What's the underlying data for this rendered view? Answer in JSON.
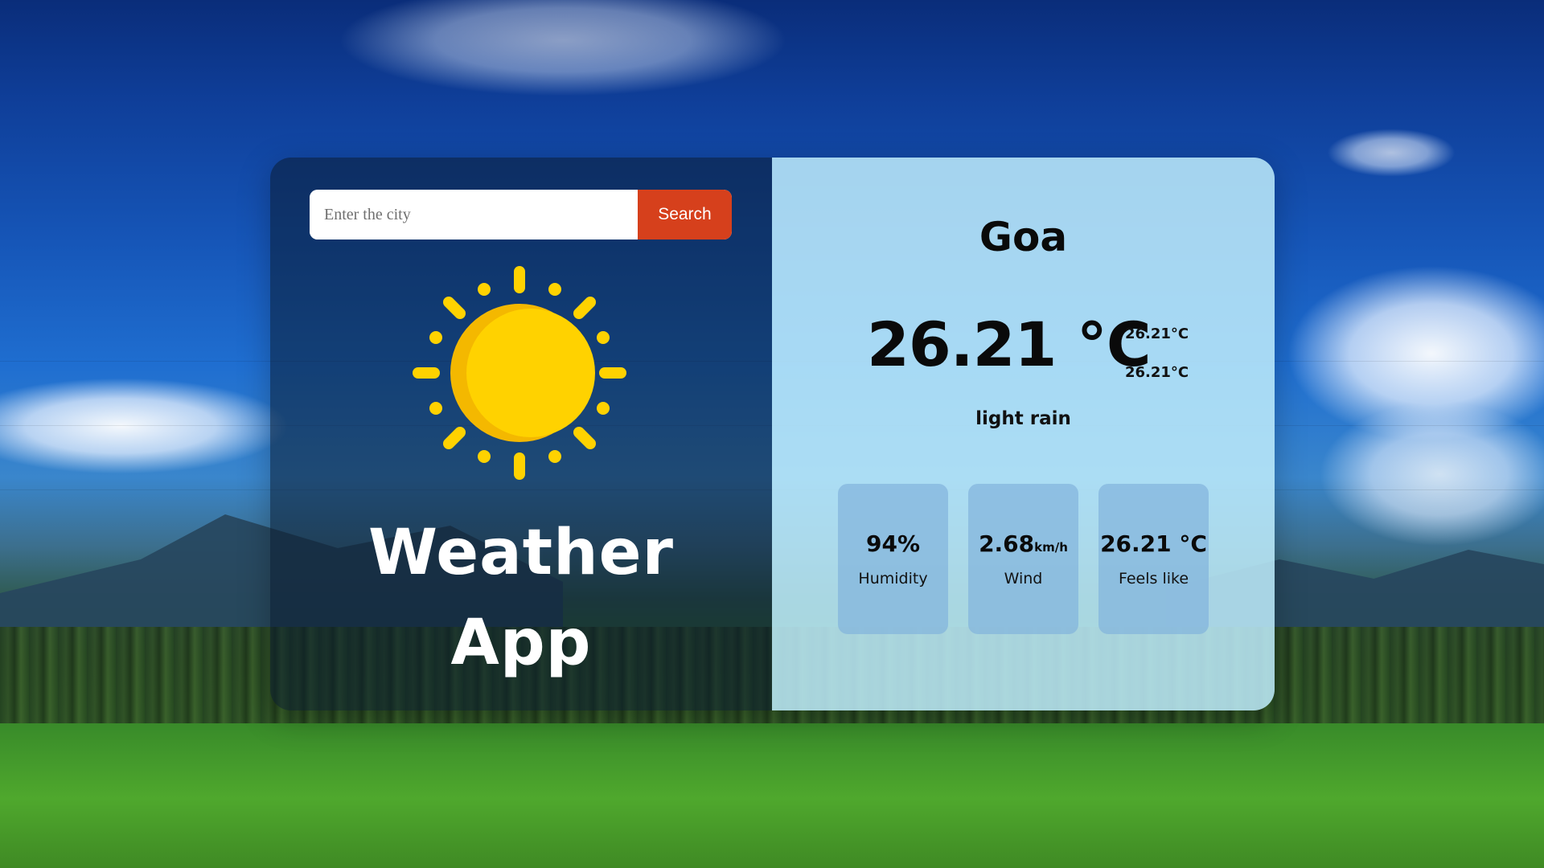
{
  "search": {
    "placeholder": "Enter the city",
    "button_label": "Search"
  },
  "hero": {
    "title_line1": "Weather",
    "title_line2": "App",
    "icon": "sun-icon"
  },
  "weather": {
    "city": "Goa",
    "temperature": "26.21 °C",
    "temp_high": "26.21°C",
    "temp_low": "26.21°C",
    "condition": "light rain"
  },
  "stats": [
    {
      "value": "94%",
      "unit": "",
      "label": "Humidity"
    },
    {
      "value": "2.68",
      "unit": "km/h",
      "label": "Wind"
    },
    {
      "value": "26.21 °C",
      "unit": "",
      "label": "Feels like"
    }
  ],
  "colors": {
    "search_button": "#d6401c",
    "sun": "#ffd200",
    "sun_shadow": "#f4b800",
    "right_panel": "#bfebf9",
    "stat_tile": "#82b4dc"
  }
}
